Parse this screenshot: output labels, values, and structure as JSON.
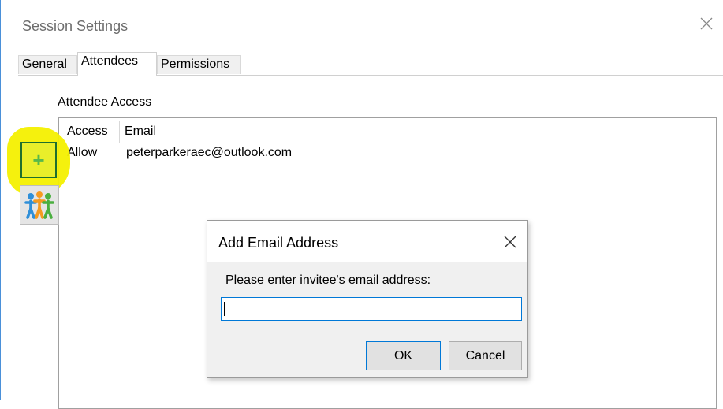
{
  "window": {
    "title": "Session Settings",
    "close_icon": "close-icon"
  },
  "tabs": [
    {
      "label": "General",
      "selected": false
    },
    {
      "label": "Attendees",
      "selected": true
    },
    {
      "label": "Permissions",
      "selected": false
    }
  ],
  "attendee_access": {
    "section_label": "Attendee Access",
    "columns": [
      "Access",
      "Email"
    ],
    "rows": [
      {
        "access": "Allow",
        "email": "peterparkeraec@outlook.com"
      }
    ],
    "add_icon": "plus-icon",
    "group_icon": "people-group-icon",
    "highlight_color": "#f4f000"
  },
  "dialog": {
    "title": "Add Email Address",
    "prompt": "Please enter invitee's email address:",
    "input_value": "",
    "ok_label": "OK",
    "cancel_label": "Cancel"
  },
  "colors": {
    "accent": "#0078d7",
    "add_button_plus": "#58b94a"
  }
}
